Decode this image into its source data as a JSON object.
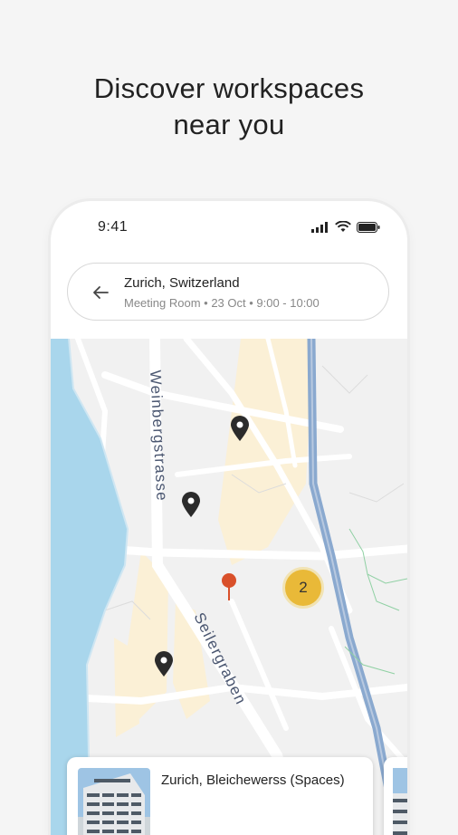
{
  "headline": {
    "line1": "Discover workspaces",
    "line2": "near you"
  },
  "status_bar": {
    "time": "9:41",
    "icons": [
      "signal-icon",
      "wifi-icon",
      "battery-icon"
    ]
  },
  "search": {
    "title": "Zurich, Switzerland",
    "subtitle": "Meeting Room • 23 Oct • 9:00 - 10:00",
    "back_icon": "arrow-left-icon"
  },
  "map": {
    "street_labels": [
      "Weinbergstrasse",
      "Seilergraben"
    ],
    "cluster_count": "2",
    "colors": {
      "water": "#a9d6ec",
      "highlight_block": "#fbf0d6",
      "rail": "#8aa9cf",
      "cluster": "#e9b938",
      "location_pin": "#d9502a",
      "marker": "#2b2b2b"
    }
  },
  "result_card": {
    "title": "Zurich, Bleichewerss (Spaces)"
  }
}
